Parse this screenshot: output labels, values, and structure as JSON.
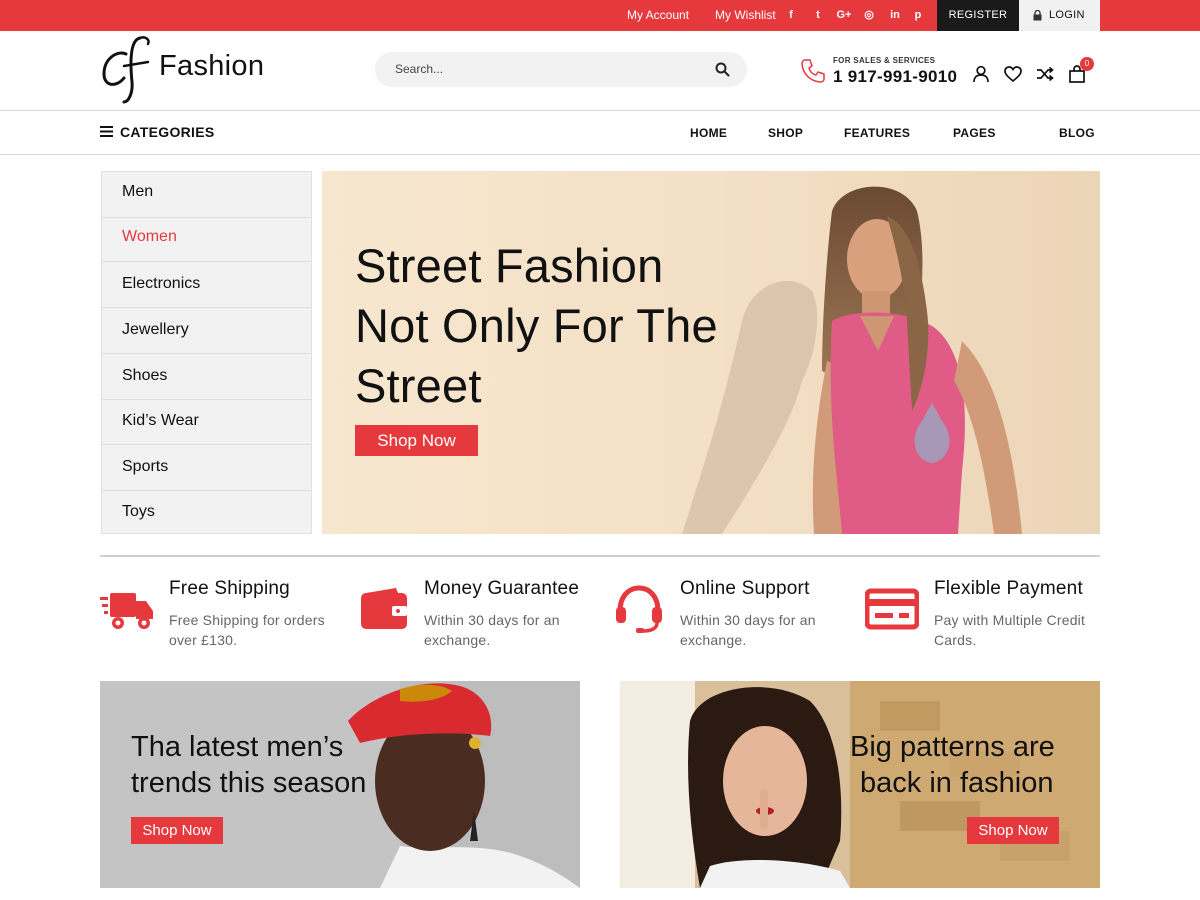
{
  "topbar": {
    "my_account": "My Account",
    "my_wishlist": "My Wishlist",
    "social_icons": [
      "facebook-icon",
      "twitter-icon",
      "google-plus-icon",
      "instagram-icon",
      "linkedin-icon",
      "pinterest-icon"
    ],
    "social_glyphs": [
      "f",
      "t",
      "G+",
      "◎",
      "in",
      "p"
    ],
    "register": "REGISTER",
    "login": "LOGIN"
  },
  "header": {
    "logo_mark": "cf",
    "logo_text": "Fashion",
    "search_placeholder": "Search...",
    "sales_label": "FOR SALES & SERVICES",
    "sales_phone": "1 917-991-9010",
    "cart_count": "0",
    "icons": [
      "user-icon",
      "heart-icon",
      "shuffle-icon",
      "bag-icon"
    ]
  },
  "nav": {
    "categories_label": "CATEGORIES",
    "items": [
      "HOME",
      "SHOP",
      "FEATURES",
      "PAGES",
      "BLOG"
    ]
  },
  "sidebar": {
    "items": [
      "Men",
      "Women",
      "Electronics",
      "Jewellery",
      "Shoes",
      "Kid’s Wear",
      "Sports",
      "Toys"
    ],
    "active": "Women"
  },
  "hero": {
    "lines": [
      "Street Fashion",
      "Not Only For The",
      "Street"
    ],
    "button": "Shop Now"
  },
  "features": [
    {
      "icon": "truck-icon",
      "title": "Free Shipping",
      "desc_lines": [
        "Free Shipping for orders",
        "over £130."
      ]
    },
    {
      "icon": "wallet-icon",
      "title": "Money Guarantee",
      "desc_lines": [
        "Within 30 days for an",
        "exchange."
      ]
    },
    {
      "icon": "headset-icon",
      "title": "Online Support",
      "desc_lines": [
        "Within 30 days for an",
        "exchange."
      ]
    },
    {
      "icon": "credit-card-icon",
      "title": "Flexible Payment",
      "desc_lines": [
        "Pay with Multiple Credit",
        "Cards."
      ]
    }
  ],
  "banners": [
    {
      "lines": [
        "Tha latest men’s",
        "trends this season"
      ],
      "button": "Shop Now"
    },
    {
      "lines": [
        "Big patterns are",
        "back in fashion"
      ],
      "button": "Shop Now"
    }
  ],
  "colors": {
    "accent": "#e5393e",
    "dark": "#1a1a1a",
    "sidebar_bg": "#f2f2f2",
    "hero_bg": "#f6e4cb"
  }
}
